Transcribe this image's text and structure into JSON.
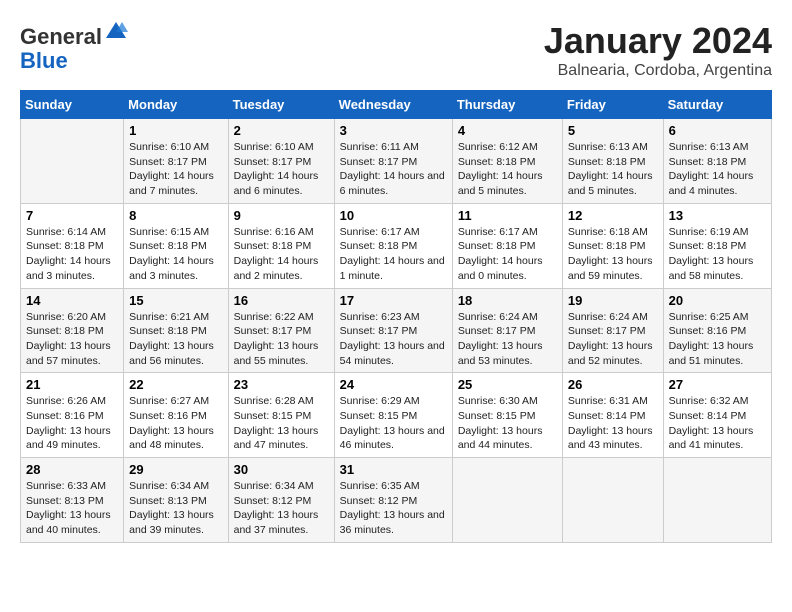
{
  "logo": {
    "general": "General",
    "blue": "Blue"
  },
  "title": "January 2024",
  "subtitle": "Balnearia, Cordoba, Argentina",
  "days_header": [
    "Sunday",
    "Monday",
    "Tuesday",
    "Wednesday",
    "Thursday",
    "Friday",
    "Saturday"
  ],
  "weeks": [
    [
      {
        "day": "",
        "sunrise": "",
        "sunset": "",
        "daylight": ""
      },
      {
        "day": "1",
        "sunrise": "Sunrise: 6:10 AM",
        "sunset": "Sunset: 8:17 PM",
        "daylight": "Daylight: 14 hours and 7 minutes."
      },
      {
        "day": "2",
        "sunrise": "Sunrise: 6:10 AM",
        "sunset": "Sunset: 8:17 PM",
        "daylight": "Daylight: 14 hours and 6 minutes."
      },
      {
        "day": "3",
        "sunrise": "Sunrise: 6:11 AM",
        "sunset": "Sunset: 8:17 PM",
        "daylight": "Daylight: 14 hours and 6 minutes."
      },
      {
        "day": "4",
        "sunrise": "Sunrise: 6:12 AM",
        "sunset": "Sunset: 8:18 PM",
        "daylight": "Daylight: 14 hours and 5 minutes."
      },
      {
        "day": "5",
        "sunrise": "Sunrise: 6:13 AM",
        "sunset": "Sunset: 8:18 PM",
        "daylight": "Daylight: 14 hours and 5 minutes."
      },
      {
        "day": "6",
        "sunrise": "Sunrise: 6:13 AM",
        "sunset": "Sunset: 8:18 PM",
        "daylight": "Daylight: 14 hours and 4 minutes."
      }
    ],
    [
      {
        "day": "7",
        "sunrise": "Sunrise: 6:14 AM",
        "sunset": "Sunset: 8:18 PM",
        "daylight": "Daylight: 14 hours and 3 minutes."
      },
      {
        "day": "8",
        "sunrise": "Sunrise: 6:15 AM",
        "sunset": "Sunset: 8:18 PM",
        "daylight": "Daylight: 14 hours and 3 minutes."
      },
      {
        "day": "9",
        "sunrise": "Sunrise: 6:16 AM",
        "sunset": "Sunset: 8:18 PM",
        "daylight": "Daylight: 14 hours and 2 minutes."
      },
      {
        "day": "10",
        "sunrise": "Sunrise: 6:17 AM",
        "sunset": "Sunset: 8:18 PM",
        "daylight": "Daylight: 14 hours and 1 minute."
      },
      {
        "day": "11",
        "sunrise": "Sunrise: 6:17 AM",
        "sunset": "Sunset: 8:18 PM",
        "daylight": "Daylight: 14 hours and 0 minutes."
      },
      {
        "day": "12",
        "sunrise": "Sunrise: 6:18 AM",
        "sunset": "Sunset: 8:18 PM",
        "daylight": "Daylight: 13 hours and 59 minutes."
      },
      {
        "day": "13",
        "sunrise": "Sunrise: 6:19 AM",
        "sunset": "Sunset: 8:18 PM",
        "daylight": "Daylight: 13 hours and 58 minutes."
      }
    ],
    [
      {
        "day": "14",
        "sunrise": "Sunrise: 6:20 AM",
        "sunset": "Sunset: 8:18 PM",
        "daylight": "Daylight: 13 hours and 57 minutes."
      },
      {
        "day": "15",
        "sunrise": "Sunrise: 6:21 AM",
        "sunset": "Sunset: 8:18 PM",
        "daylight": "Daylight: 13 hours and 56 minutes."
      },
      {
        "day": "16",
        "sunrise": "Sunrise: 6:22 AM",
        "sunset": "Sunset: 8:17 PM",
        "daylight": "Daylight: 13 hours and 55 minutes."
      },
      {
        "day": "17",
        "sunrise": "Sunrise: 6:23 AM",
        "sunset": "Sunset: 8:17 PM",
        "daylight": "Daylight: 13 hours and 54 minutes."
      },
      {
        "day": "18",
        "sunrise": "Sunrise: 6:24 AM",
        "sunset": "Sunset: 8:17 PM",
        "daylight": "Daylight: 13 hours and 53 minutes."
      },
      {
        "day": "19",
        "sunrise": "Sunrise: 6:24 AM",
        "sunset": "Sunset: 8:17 PM",
        "daylight": "Daylight: 13 hours and 52 minutes."
      },
      {
        "day": "20",
        "sunrise": "Sunrise: 6:25 AM",
        "sunset": "Sunset: 8:16 PM",
        "daylight": "Daylight: 13 hours and 51 minutes."
      }
    ],
    [
      {
        "day": "21",
        "sunrise": "Sunrise: 6:26 AM",
        "sunset": "Sunset: 8:16 PM",
        "daylight": "Daylight: 13 hours and 49 minutes."
      },
      {
        "day": "22",
        "sunrise": "Sunrise: 6:27 AM",
        "sunset": "Sunset: 8:16 PM",
        "daylight": "Daylight: 13 hours and 48 minutes."
      },
      {
        "day": "23",
        "sunrise": "Sunrise: 6:28 AM",
        "sunset": "Sunset: 8:15 PM",
        "daylight": "Daylight: 13 hours and 47 minutes."
      },
      {
        "day": "24",
        "sunrise": "Sunrise: 6:29 AM",
        "sunset": "Sunset: 8:15 PM",
        "daylight": "Daylight: 13 hours and 46 minutes."
      },
      {
        "day": "25",
        "sunrise": "Sunrise: 6:30 AM",
        "sunset": "Sunset: 8:15 PM",
        "daylight": "Daylight: 13 hours and 44 minutes."
      },
      {
        "day": "26",
        "sunrise": "Sunrise: 6:31 AM",
        "sunset": "Sunset: 8:14 PM",
        "daylight": "Daylight: 13 hours and 43 minutes."
      },
      {
        "day": "27",
        "sunrise": "Sunrise: 6:32 AM",
        "sunset": "Sunset: 8:14 PM",
        "daylight": "Daylight: 13 hours and 41 minutes."
      }
    ],
    [
      {
        "day": "28",
        "sunrise": "Sunrise: 6:33 AM",
        "sunset": "Sunset: 8:13 PM",
        "daylight": "Daylight: 13 hours and 40 minutes."
      },
      {
        "day": "29",
        "sunrise": "Sunrise: 6:34 AM",
        "sunset": "Sunset: 8:13 PM",
        "daylight": "Daylight: 13 hours and 39 minutes."
      },
      {
        "day": "30",
        "sunrise": "Sunrise: 6:34 AM",
        "sunset": "Sunset: 8:12 PM",
        "daylight": "Daylight: 13 hours and 37 minutes."
      },
      {
        "day": "31",
        "sunrise": "Sunrise: 6:35 AM",
        "sunset": "Sunset: 8:12 PM",
        "daylight": "Daylight: 13 hours and 36 minutes."
      },
      {
        "day": "",
        "sunrise": "",
        "sunset": "",
        "daylight": ""
      },
      {
        "day": "",
        "sunrise": "",
        "sunset": "",
        "daylight": ""
      },
      {
        "day": "",
        "sunrise": "",
        "sunset": "",
        "daylight": ""
      }
    ]
  ]
}
